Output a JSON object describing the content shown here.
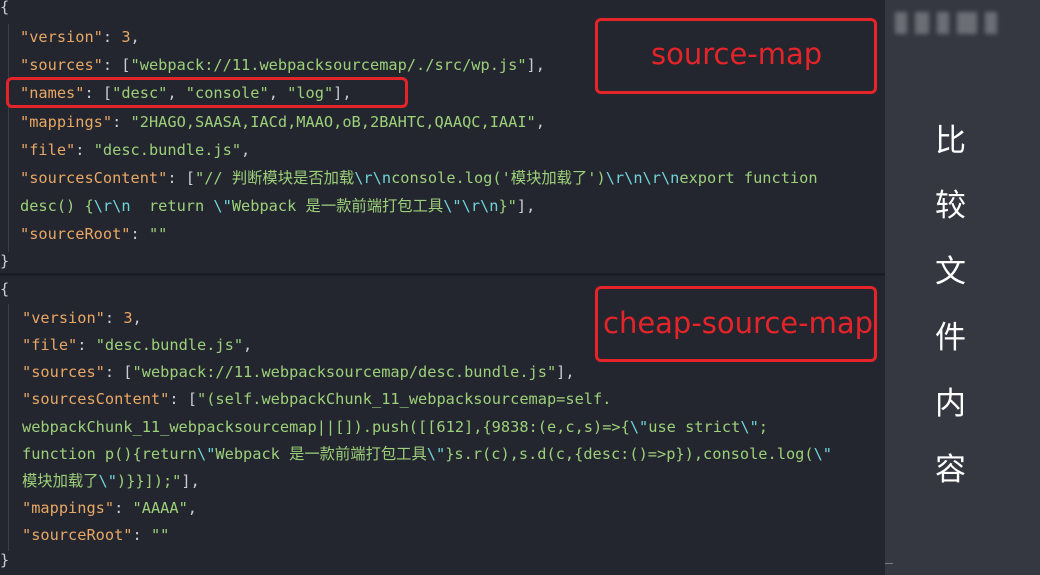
{
  "panel_top": {
    "open_brace": "{",
    "close_brace": "}",
    "lines": {
      "version_key": "\"version\"",
      "version_sep": ": ",
      "version_val": "3",
      "version_end": ",",
      "sources_key": "\"sources\"",
      "sources_sep": ": [",
      "sources_val": "\"webpack://11.webpacksourcemap/./src/wp.js\"",
      "sources_end": "],",
      "names_key": "\"names\"",
      "names_sep": ": [",
      "names_v1": "\"desc\"",
      "names_c1": ", ",
      "names_v2": "\"console\"",
      "names_c2": ", ",
      "names_v3": "\"log\"",
      "names_end": "],",
      "mappings_key": "\"mappings\"",
      "mappings_sep": ": ",
      "mappings_val": "\"2HAGO,SAASA,IACd,MAAO,oB,2BAHTC,QAAQC,IAAI\"",
      "mappings_end": ",",
      "file_key": "\"file\"",
      "file_sep": ": ",
      "file_val": "\"desc.bundle.js\"",
      "file_end": ",",
      "sc_key": "\"sourcesContent\"",
      "sc_sep": ": [",
      "sc_a": "\"// 判断模块是否加载",
      "sc_e1": "\\r\\n",
      "sc_b": "console.log('模块加载了')",
      "sc_e2": "\\r\\n\\r\\n",
      "sc_c": "export function",
      "sc2_a": "desc() {",
      "sc2_e1": "\\r\\n",
      "sc2_b": "  return ",
      "sc2_e2": "\\\"",
      "sc2_c": "Webpack 是一款前端打包工具",
      "sc2_e3": "\\\"\\r\\n",
      "sc2_d": "}\"",
      "sc2_end": "],",
      "root_key": "\"sourceRoot\"",
      "root_sep": ": ",
      "root_val": "\"\""
    },
    "tag": "source-map"
  },
  "panel_bottom": {
    "open_brace": "{",
    "close_brace": "}",
    "lines": {
      "version_key": "\"version\"",
      "version_sep": ": ",
      "version_val": "3",
      "version_end": ",",
      "file_key": "\"file\"",
      "file_sep": ": ",
      "file_val": "\"desc.bundle.js\"",
      "file_end": ",",
      "sources_key": "\"sources\"",
      "sources_sep": ": [",
      "sources_val": "\"webpack://11.webpacksourcemap/desc.bundle.js\"",
      "sources_end": "],",
      "sc_key": "\"sourcesContent\"",
      "sc_sep": ": [",
      "sc_a": "\"(self.webpackChunk_11_webpacksourcemap=self.",
      "sc2_a": "webpackChunk_11_webpacksourcemap||[]).push([[612],{9838:(e,c,s)=>{",
      "sc2_e1": "\\\"",
      "sc2_b": "use strict",
      "sc2_e2": "\\\"",
      "sc2_c": ";",
      "sc3_a": "function p(){return",
      "sc3_e1": "\\\"",
      "sc3_b": "Webpack 是一款前端打包工具",
      "sc3_e2": "\\\"",
      "sc3_c": "}s.r(c),s.d(c,{desc:()=>p}),console.log(",
      "sc3_e3": "\\\"",
      "sc4_a": "模块加载了",
      "sc4_e1": "\\\"",
      "sc4_b": ")}}]);\"",
      "sc4_end": "],",
      "mappings_key": "\"mappings\"",
      "mappings_sep": ": ",
      "mappings_val": "\"AAAA\"",
      "mappings_end": ",",
      "root_key": "\"sourceRoot\"",
      "root_sep": ": ",
      "root_val": "\"\""
    },
    "tag": "cheap-source-map"
  },
  "sidebar": {
    "chars": [
      "比",
      "较",
      "文",
      "件",
      "内",
      "容"
    ]
  },
  "colors": {
    "key": "#e8a765",
    "string": "#9cd07a",
    "escape": "#6fd4d9",
    "highlight": "#e5242a"
  }
}
